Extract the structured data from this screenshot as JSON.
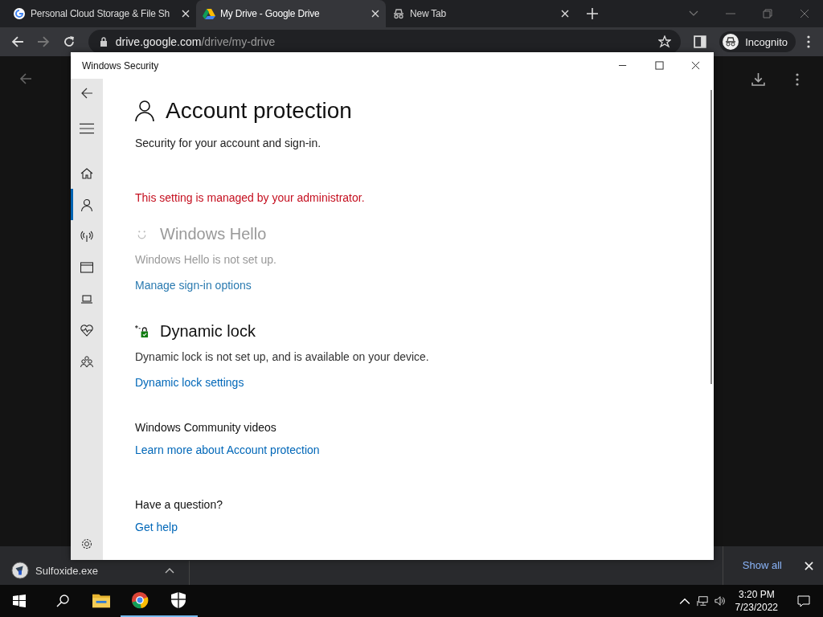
{
  "browser": {
    "tabs": [
      {
        "title": "Personal Cloud Storage & File Sh",
        "kind": "google",
        "selected": false
      },
      {
        "title": "My Drive - Google Drive",
        "kind": "drive",
        "selected": true
      },
      {
        "title": "New Tab",
        "kind": "incognito",
        "selected": false
      }
    ],
    "url": {
      "host": "drive.google.com",
      "path": "/drive/my-drive"
    },
    "profile": "Incognito"
  },
  "security_window": {
    "title": "Windows Security",
    "nav": [
      {
        "kind": "home",
        "selected": false
      },
      {
        "kind": "account",
        "selected": true
      },
      {
        "kind": "network",
        "selected": false
      },
      {
        "kind": "browser",
        "selected": false
      },
      {
        "kind": "device",
        "selected": false
      },
      {
        "kind": "health",
        "selected": false
      },
      {
        "kind": "family",
        "selected": false
      }
    ],
    "page": {
      "title": "Account protection",
      "subtitle": "Security for your account and sign-in.",
      "notice": "This setting is managed by your administrator.",
      "sections": [
        {
          "kind": "hello",
          "title": "Windows Hello",
          "disabled": true,
          "description": "Windows Hello is not set up.",
          "link": "Manage sign-in options"
        },
        {
          "kind": "lock",
          "title": "Dynamic lock",
          "disabled": false,
          "description": "Dynamic lock is not set up, and is available on your device.",
          "link": "Dynamic lock settings"
        }
      ],
      "community": {
        "title": "Windows Community videos",
        "link": "Learn more about Account protection"
      },
      "question": {
        "title": "Have a question?",
        "link": "Get help"
      }
    }
  },
  "download_bar": {
    "file": "Sulfoxide.exe",
    "show_all": "Show all"
  },
  "taskbar": {
    "apps": [
      {
        "kind": "explorer",
        "active": false
      },
      {
        "kind": "chrome",
        "active": true
      },
      {
        "kind": "security",
        "active": true
      }
    ],
    "clock": {
      "time": "3:20 PM",
      "date": "7/23/2022"
    }
  }
}
